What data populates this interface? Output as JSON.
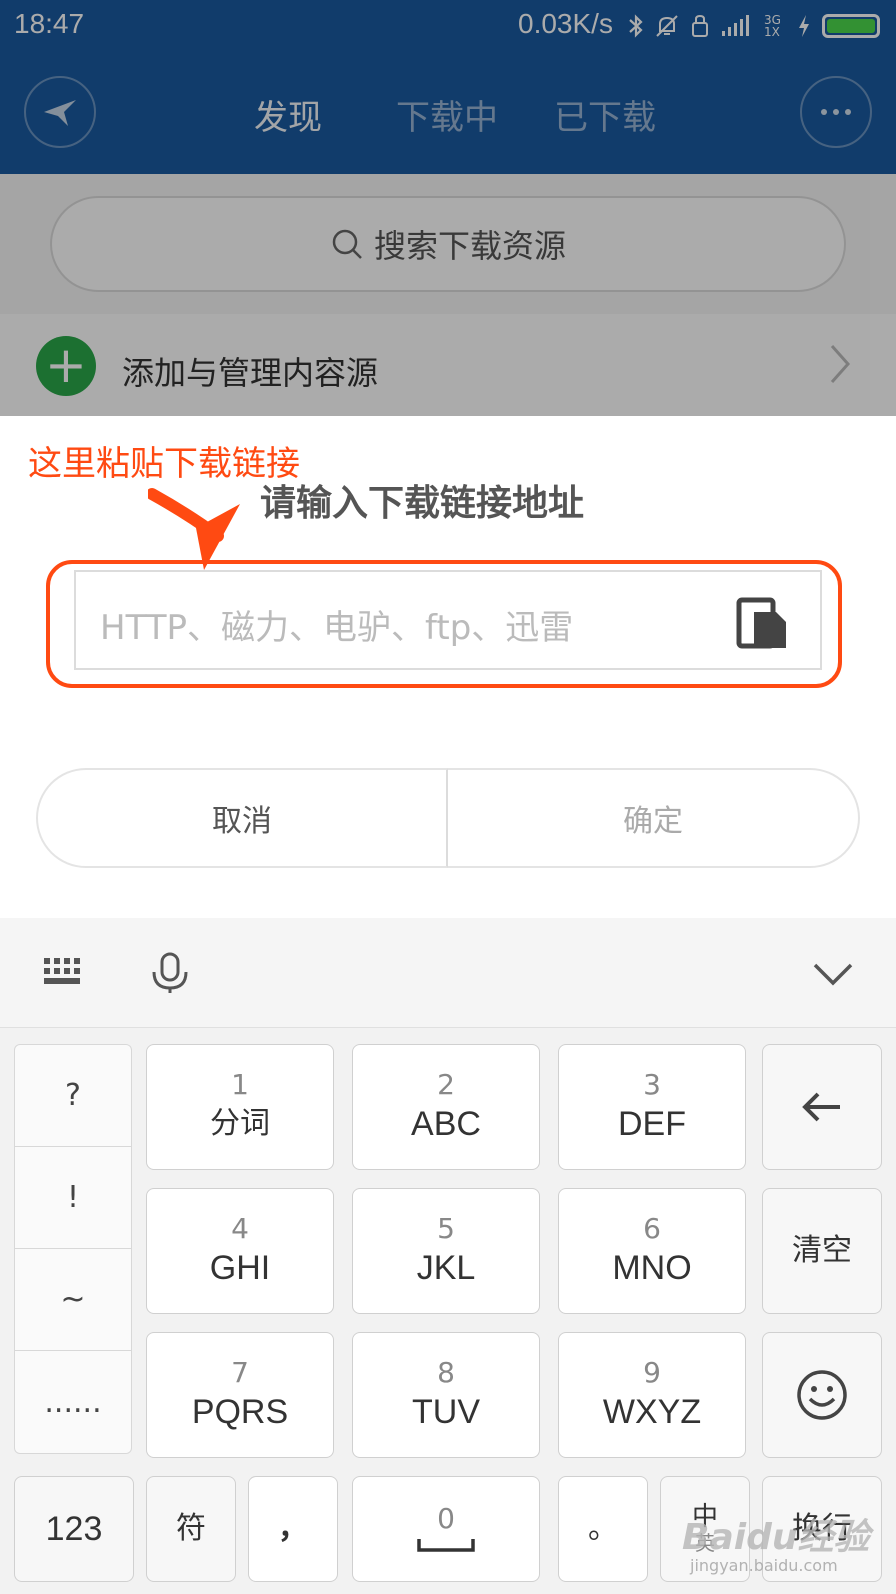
{
  "status_bar": {
    "time": "18:47",
    "net_speed": "0.03K/s",
    "network": "3G 1X",
    "icons": [
      "bluetooth-icon",
      "bell-muted-icon",
      "lock-icon",
      "signal-icon",
      "charging-icon",
      "battery-icon"
    ],
    "battery_color": "#4cd84c"
  },
  "header": {
    "tabs": [
      {
        "label": "发现",
        "active": true
      },
      {
        "label": "下载中",
        "active": false
      },
      {
        "label": "已下载",
        "active": false
      }
    ],
    "brand_color": "#1a5aa0"
  },
  "page": {
    "search_placeholder": "搜索下载资源",
    "add_source_label": "添加与管理内容源"
  },
  "dialog": {
    "annotation": "这里粘贴下载链接",
    "annotation_color": "#ff4a12",
    "title": "请输入下载链接地址",
    "input_placeholder": "HTTP、磁力、电驴、ftp、迅雷",
    "input_value": "",
    "cancel_label": "取消",
    "confirm_label": "确定"
  },
  "keyboard": {
    "symbols": [
      "?",
      "!",
      "~",
      "......"
    ],
    "keys": [
      {
        "num": "1",
        "label": "分词"
      },
      {
        "num": "2",
        "label": "ABC"
      },
      {
        "num": "3",
        "label": "DEF"
      },
      {
        "num": "4",
        "label": "GHI"
      },
      {
        "num": "5",
        "label": "JKL"
      },
      {
        "num": "6",
        "label": "MNO"
      },
      {
        "num": "7",
        "label": "PQRS"
      },
      {
        "num": "8",
        "label": "TUV"
      },
      {
        "num": "9",
        "label": "WXYZ"
      }
    ],
    "clear_label": "清空",
    "bottom": {
      "num_switch": "123",
      "symbol_key": "符",
      "comma_key": "，",
      "space_num": "0",
      "period_key": "。",
      "lang_key": "中",
      "lang_sub": "英",
      "enter_key": "换行"
    }
  },
  "watermark": {
    "text": "Baidu经验",
    "url": "jingyan.baidu.com"
  }
}
